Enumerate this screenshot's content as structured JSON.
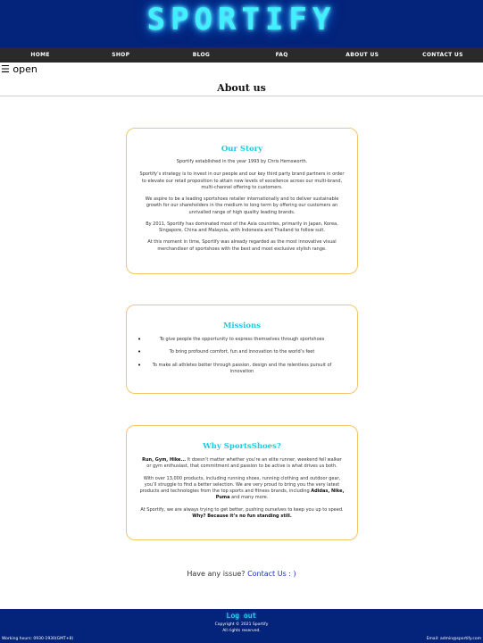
{
  "header": {
    "logo_text": "SPORTIFY"
  },
  "nav": {
    "items": [
      "HOME",
      "SHOP",
      "BLOG",
      "FAQ",
      "ABOUT US",
      "CONTACT US"
    ]
  },
  "menu_toggle": {
    "icon": "☰",
    "label": "open"
  },
  "page": {
    "title": "About us"
  },
  "story": {
    "title": "Our Story",
    "paragraphs": [
      "Sportify established in the year 1993 by Chris Hemsworth.",
      "Sportify’s strategy is to invest in our people and our key third party brand partners in order to elevate our retail proposition to attain new levels of excellence across our multi-brand, multi-channel offering to customers.",
      "We aspire to be a leading sportshoes retailer internationally and to deliver sustainable growth for our shareholders in the medium to long term by offering our customers an unrivalled range of high quality leading brands.",
      "By 2011, Sportify has dominated most of the Asia countries, primarily in Japan, Korea, Singapore, China and Malaysia, with Indonesia and Thailand to follow suit.",
      "At this moment in time, Sportify was already regarded as the most innovative visual merchandiser of sportshoes with the best and most exclusive stylish range."
    ]
  },
  "missions": {
    "title": "Missions",
    "items": [
      "To give people the opportunity to express themselves through sportshoes",
      "To bring profound comfort, fun and innovation to the world’s feet",
      "To make all athletes better through passion, design and the relentless pursuit of innovation"
    ]
  },
  "why": {
    "title": "Why SportsShoes?",
    "p1_bold": "Run, Gym, Hike...",
    "p1_rest": " It doesn’t matter whether you’re an elite runner, weekend fell walker or gym enthusiast, that commitment and passion to be active is what drives us both.",
    "p2_start": "With over 13,000 products, including running shoes, running clothing and outdoor gear, you’ll struggle to find a better selection. We are very proud to bring you the very latest products and technologies from the top sports and fitness brands, including ",
    "p2_brands": "Adidas, Nike, Puma",
    "p2_end": " and many more.",
    "p3_start": "At Sportify, we are always trying to get better, pushing ourselves to keep you up to speed. ",
    "p3_bold": "Why? Because it’s no fun standing still."
  },
  "issue": {
    "text": "Have any issue? ",
    "link": "Contact Us : )"
  },
  "footer": {
    "logout": "Log out",
    "copyright": "Copyright © 2021 Sportify",
    "rights": "All rights reserved.",
    "hours": "Working hours: 0930-1930(GMT+8)",
    "email": "Email: admin@sportify.com"
  }
}
